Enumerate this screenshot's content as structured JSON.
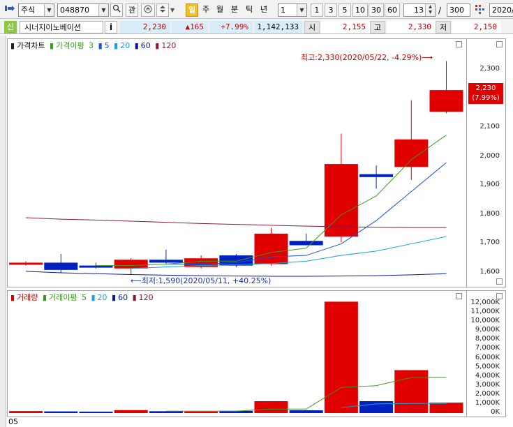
{
  "toolbar": {
    "market_select": "주식",
    "code_input": "048870",
    "watch_label": "관",
    "period_buttons": [
      "일",
      "주",
      "월",
      "분",
      "틱",
      "년"
    ],
    "active_period": "일",
    "interval_select": "1",
    "interval_buttons": [
      "1",
      "3",
      "5",
      "10",
      "30",
      "60"
    ],
    "count_value": "13",
    "count_separator": "/",
    "count_max": "300",
    "date_input": "2020/"
  },
  "infobar": {
    "badge": "신",
    "stock_name": "시너지이노베이션",
    "info_button": "i",
    "price": "2,230",
    "change": "▲165",
    "change_pct": "+7.99%",
    "volume": "1,142,133",
    "open_label": "시",
    "open_value": "2,155",
    "high_label": "고",
    "high_value": "2,330",
    "low_label": "저",
    "low_value": "2,150"
  },
  "price_pane": {
    "legend_title": "가격차트",
    "legend_ma_prefix": "가격이평",
    "ma_labels": [
      "3",
      "5",
      "20",
      "60",
      "120"
    ],
    "ma_colors": [
      "#3c9a1e",
      "#1a50e0",
      "#18a0e0",
      "#0818a0",
      "#8a1840"
    ],
    "y_ticks": [
      "2,300",
      "2,200",
      "2,100",
      "2,000",
      "1,900",
      "1,800",
      "1,700",
      "1,600"
    ],
    "current_price_tag": "2,230",
    "current_pct_tag": "(7.99%)",
    "high_annotation": "최고:2,330(2020/05/22, -4.29%)⟶",
    "low_annotation": "⟵최저:1,590(2020/05/11, +40.25%)"
  },
  "volume_pane": {
    "legend_title": "거래량",
    "legend_ma_prefix": "거래이평",
    "ma_labels": [
      "5",
      "20",
      "60",
      "120"
    ],
    "y_ticks": [
      "12,000K",
      "11,000K",
      "10,000K",
      "9,000K",
      "8,000K",
      "7,000K",
      "6,000K",
      "5,000K",
      "4,000K",
      "3,000K",
      "2,000K",
      "1,000K",
      "0K"
    ]
  },
  "footer": {
    "date_label": "05"
  },
  "chart_data": {
    "type": "candlestick",
    "up_color": "#e00000",
    "down_color": "#0020c0",
    "candles": [
      {
        "o": 1630,
        "h": 1640,
        "l": 1625,
        "c": 1635,
        "vol": 220
      },
      {
        "o": 1635,
        "h": 1665,
        "l": 1600,
        "c": 1610,
        "vol": 180
      },
      {
        "o": 1625,
        "h": 1635,
        "l": 1615,
        "c": 1620,
        "vol": 150
      },
      {
        "o": 1615,
        "h": 1650,
        "l": 1595,
        "c": 1645,
        "vol": 320
      },
      {
        "o": 1645,
        "h": 1680,
        "l": 1630,
        "c": 1635,
        "vol": 200
      },
      {
        "o": 1620,
        "h": 1660,
        "l": 1615,
        "c": 1650,
        "vol": 170
      },
      {
        "o": 1660,
        "h": 1665,
        "l": 1620,
        "c": 1625,
        "vol": 240
      },
      {
        "o": 1630,
        "h": 1755,
        "l": 1625,
        "c": 1735,
        "vol": 1300
      },
      {
        "o": 1710,
        "h": 1735,
        "l": 1705,
        "c": 1695,
        "vol": 300
      },
      {
        "o": 1725,
        "h": 2080,
        "l": 1705,
        "c": 1975,
        "vol": 12200
      },
      {
        "o": 1940,
        "h": 1970,
        "l": 1890,
        "c": 1930,
        "vol": 1300
      },
      {
        "o": 1965,
        "h": 2195,
        "l": 1920,
        "c": 2060,
        "vol": 4700
      },
      {
        "o": 2155,
        "h": 2330,
        "l": 2150,
        "c": 2230,
        "vol": 1142
      }
    ],
    "ma3": [
      null,
      null,
      1625,
      1625,
      1630,
      1640,
      1640,
      1670,
      1685,
      1800,
      1865,
      1990,
      2075
    ],
    "ma5": [
      null,
      null,
      null,
      null,
      1630,
      1630,
      1635,
      1655,
      1660,
      1700,
      1780,
      1880,
      1980
    ],
    "ma20": [
      null,
      null,
      null,
      1615,
      1620,
      1625,
      1628,
      1632,
      1640,
      1660,
      1675,
      1700,
      1725
    ],
    "ma60": [
      1605,
      1600,
      1597,
      1594,
      1592,
      1590,
      1589,
      1588,
      1588,
      1589,
      1590,
      1593,
      1597
    ],
    "ma120": [
      1790,
      1785,
      1782,
      1778,
      1774,
      1770,
      1767,
      1764,
      1761,
      1759,
      1757,
      1756,
      1756
    ],
    "vol_ma5": [
      null,
      null,
      null,
      null,
      210,
      210,
      210,
      440,
      440,
      2800,
      3000,
      3900,
      3900
    ],
    "vol_ma20": [
      null,
      null,
      null,
      null,
      null,
      null,
      null,
      null,
      null,
      600,
      1000,
      1050,
      1050
    ]
  }
}
